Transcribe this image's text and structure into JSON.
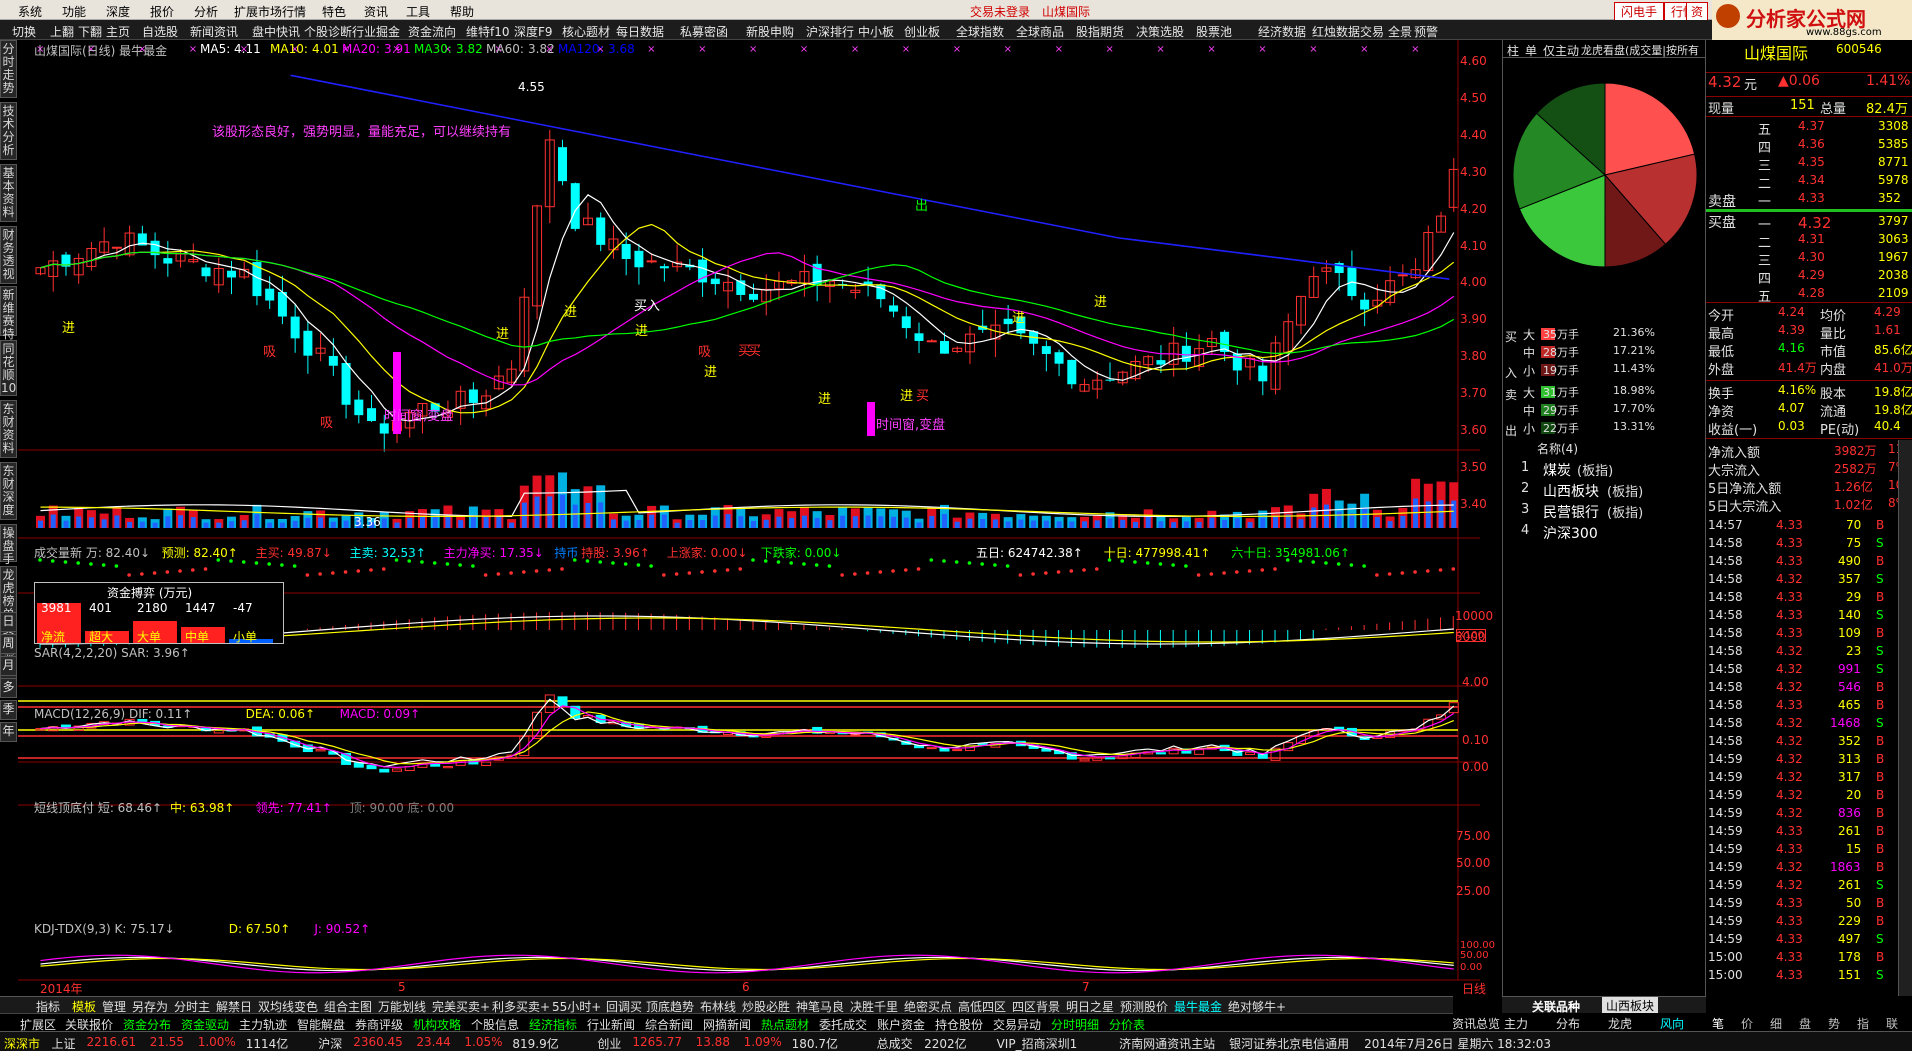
{
  "menu": {
    "items": [
      "系统",
      "功能",
      "深度",
      "报价",
      "分析",
      "扩展市场行情",
      "特色",
      "资讯",
      "工具",
      "帮助"
    ],
    "login_status": "交易未登录",
    "stock_name_top": "山煤国际",
    "right_buttons": [
      "闪电手",
      "行情",
      "资"
    ]
  },
  "toolbar": {
    "items": [
      "切换",
      "上翻",
      "下翻",
      "主页",
      "自选股",
      "新闻资讯",
      "盘中快讯",
      "个股诊断",
      "行业掘金",
      "资金流向",
      "维特f10",
      "深度F9",
      "核心题材",
      "每日数据",
      "私募密函",
      "新股申购",
      "沪深排行",
      "中小板",
      "创业板",
      "全球指数",
      "全球商品",
      "股指期货",
      "决策选股",
      "股票池",
      "经济数据",
      "红烛数据",
      "交易",
      "全景",
      "预警"
    ]
  },
  "logo": {
    "text": "分析家公式网",
    "url_text": "www.88gs.com"
  },
  "left_tabs": [
    "分时走势",
    "技术分析",
    "基本资料",
    "财务透视",
    "新维赛特",
    "同花顺10",
    "东财资料",
    "东财深度",
    "操盘手",
    "龙虎榜单",
    "资金流向"
  ],
  "period_tabs": [
    "日",
    "周",
    "月",
    "多",
    "季",
    "年"
  ],
  "main_chart": {
    "title": "山煤国际(日线) 最牛最金",
    "ma": [
      {
        "name": "MA5:",
        "value": "4.11",
        "color": "#ffffff"
      },
      {
        "name": "MA10:",
        "value": "4.01",
        "color": "#ffff00"
      },
      {
        "name": "MA20:",
        "value": "3.91",
        "color": "#ff00ff"
      },
      {
        "name": "MA30:",
        "value": "3.82",
        "color": "#00ff00"
      },
      {
        "name": "MA60:",
        "value": "3.82",
        "color": "#c0c0c0"
      },
      {
        "name": "MA120:",
        "value": "3.68",
        "color": "#0000ff"
      }
    ],
    "annotation": "该股形态良好，强势明显，量能充足，可以继续持有",
    "high_label": "4.55",
    "low_label": "3.36",
    "y_ticks": [
      "4.60",
      "4.50",
      "4.40",
      "4.30",
      "4.20",
      "4.10",
      "4.00",
      "3.90",
      "3.80",
      "3.70",
      "3.60",
      "3.50",
      "3.40"
    ],
    "signals": [
      "进",
      "进",
      "进",
      "进",
      "进",
      "进",
      "进",
      "进",
      "进",
      "出",
      "吸",
      "吸",
      "吸",
      "买",
      "买",
      "买",
      "时间窗,变盘",
      "时间窗,变盘",
      "买入"
    ]
  },
  "volume_panel": {
    "header": "成交量新 万: 82.40↓ 预测: 82.40↑ 主买: 49.87↓ 主卖: 32.53↑ 主力净买: 17.35↓ 持币 持股: 3.96↑ 上涨家: 0.00↓ 下跌家: 0.00↓",
    "header_parts": [
      {
        "t": "成交量新 万: 82.40↓",
        "c": "#c0c0c0"
      },
      {
        "t": "预测: 82.40↑",
        "c": "#ffff00"
      },
      {
        "t": "主买: 49.87↓",
        "c": "#ff3030"
      },
      {
        "t": "主卖: 32.53↑",
        "c": "#00ffff"
      },
      {
        "t": "主力净买: 17.35↓",
        "c": "#ff00ff"
      },
      {
        "t": "持币",
        "c": "#0080ff"
      },
      {
        "t": "持股: 3.96↑",
        "c": "#ff3030"
      },
      {
        "t": "上涨家: 0.00↓",
        "c": "#ff3030"
      },
      {
        "t": "下跌家: 0.00↓",
        "c": "#00ff00"
      }
    ],
    "right_header": [
      {
        "t": "五日: 624742.38↑",
        "c": "#ffffff"
      },
      {
        "t": "十日: 477998.41↑",
        "c": "#ffff00"
      },
      {
        "t": "六十日: 354981.06↑",
        "c": "#00ff00"
      }
    ],
    "y_ticks": [
      "10000",
      "5000",
      "X100"
    ],
    "fund_box": {
      "title": "资金搏弈 (万元)",
      "values": [
        "3981",
        "401",
        "2180",
        "1447",
        "-47"
      ],
      "labels": [
        "净流",
        "超大",
        "大单",
        "中单",
        "小单"
      ]
    }
  },
  "sar_panel": {
    "header": "SAR(4,2,2,20) SAR: 3.96↑",
    "y_ticks": [
      "4.00"
    ]
  },
  "macd_panel": {
    "header_parts": [
      {
        "t": "MACD(12,26,9) DIF: 0.11↑",
        "c": "#c0c0c0"
      },
      {
        "t": "DEA: 0.06↑",
        "c": "#ffff00"
      },
      {
        "t": "MACD: 0.09↑",
        "c": "#ff00ff"
      }
    ],
    "y_ticks": [
      "0.10",
      "0.00"
    ]
  },
  "short_panel": {
    "header_parts": [
      {
        "t": "短线顶底付 短: 68.46↑",
        "c": "#c0c0c0"
      },
      {
        "t": "中: 63.98↑",
        "c": "#ffff00"
      },
      {
        "t": "领先: 77.41↑",
        "c": "#ff00ff"
      },
      {
        "t": "顶: 90.00 底: 0.00",
        "c": "#808080"
      }
    ],
    "y_ticks": [
      "75.00",
      "50.00",
      "25.00"
    ]
  },
  "kdj_panel": {
    "header_parts": [
      {
        "t": "KDJ-TDX(9,3) K: 75.17↓",
        "c": "#c0c0c0"
      },
      {
        "t": "D: 67.50↑",
        "c": "#ffff00"
      },
      {
        "t": "J: 90.52↑",
        "c": "#ff00ff"
      }
    ],
    "y_ticks": [
      "100.00",
      "50.00",
      "0.00"
    ]
  },
  "x_axis": {
    "labels": [
      "2014年",
      "5",
      "6",
      "7"
    ],
    "right": "日线"
  },
  "mid_panel": {
    "tabs": [
      "柱",
      "单",
      "仅主动",
      "龙虎看盘(成交量|按所有"
    ],
    "flow": {
      "buy": [
        {
          "size": "大",
          "vol": "35万手",
          "pct": "21.36%",
          "color": "#ff4040"
        },
        {
          "size": "中",
          "vol": "28万手",
          "pct": "17.21%",
          "color": "#c02828"
        },
        {
          "size": "小",
          "vol": "19万手",
          "pct": "11.43%",
          "color": "#701818"
        }
      ],
      "sell": [
        {
          "size": "大",
          "vol": "31万手",
          "pct": "18.98%",
          "color": "#30c030"
        },
        {
          "size": "中",
          "vol": "29万手",
          "pct": "17.70%",
          "color": "#208020"
        },
        {
          "size": "小",
          "vol": "22万手",
          "pct": "13.31%",
          "color": "#104810"
        }
      ],
      "buy_label": [
        "买",
        "入"
      ],
      "sell_label": [
        "卖",
        "出"
      ]
    },
    "related_title": "名称(4)",
    "related": [
      {
        "n": "1",
        "name": "煤炭",
        "tag": "(板指)"
      },
      {
        "n": "2",
        "name": "山西板块",
        "tag": "(板指)"
      },
      {
        "n": "3",
        "name": "民营银行",
        "tag": "(板指)"
      },
      {
        "n": "4",
        "name": "沪深300",
        "tag": ""
      }
    ],
    "bottom_tabs": [
      "关联品种",
      "山西板块"
    ],
    "pie": {
      "values": [
        21.36,
        17.21,
        11.43,
        18.98,
        17.7,
        13.31
      ],
      "colors": [
        "#ff5050",
        "#b83030",
        "#701818",
        "#3cc83c",
        "#248824",
        "#145014"
      ]
    }
  },
  "quote": {
    "name": "山煤国际",
    "code": "600546",
    "price": "4.32",
    "price_unit": "元",
    "change": "▲0.06",
    "change_pct": "1.41%",
    "now_vol_label": "现量",
    "now_vol": "151",
    "total_label": "总量",
    "total": "82.4万",
    "sell": [
      {
        "l": "五",
        "p": "4.37",
        "v": "3308"
      },
      {
        "l": "四",
        "p": "4.36",
        "v": "5385"
      },
      {
        "l": "三",
        "p": "4.35",
        "v": "8771"
      },
      {
        "l": "二",
        "p": "4.34",
        "v": "5978"
      },
      {
        "l": "一",
        "p": "4.33",
        "v": "352"
      }
    ],
    "buy": [
      {
        "l": "一",
        "p": "4.32",
        "v": "3797"
      },
      {
        "l": "二",
        "p": "4.31",
        "v": "3063"
      },
      {
        "l": "三",
        "p": "4.30",
        "v": "1967"
      },
      {
        "l": "四",
        "p": "4.29",
        "v": "2038"
      },
      {
        "l": "五",
        "p": "4.28",
        "v": "2109"
      }
    ],
    "sell_label": "卖盘",
    "buy_label": "买盘",
    "stats": [
      [
        "今开",
        "4.24",
        "均价",
        "4.29"
      ],
      [
        "最高",
        "4.39",
        "量比",
        "1.61"
      ],
      [
        "最低",
        "4.16",
        "市值",
        "85.6亿"
      ],
      [
        "外盘",
        "41.4万",
        "内盘",
        "41.0万"
      ]
    ],
    "stats2": [
      [
        "换手",
        "4.16%",
        "股本",
        "19.8亿"
      ],
      [
        "净资",
        "4.07",
        "流通",
        "19.8亿"
      ],
      [
        "收益(一)",
        "0.03",
        "PE(动)",
        "40.4"
      ]
    ],
    "flows": [
      [
        "净流入额",
        "3982万",
        "11%"
      ],
      [
        "大宗流入",
        "2582万",
        "7%"
      ],
      [
        "5日净流入额",
        "1.26亿",
        "10%"
      ],
      [
        "5日大宗流入",
        "1.02亿",
        "8%"
      ]
    ]
  },
  "ticks": [
    [
      "14:57",
      "4.33",
      "70",
      "B"
    ],
    [
      "14:58",
      "4.33",
      "75",
      "S"
    ],
    [
      "14:58",
      "4.33",
      "490",
      "B"
    ],
    [
      "14:58",
      "4.32",
      "357",
      "S"
    ],
    [
      "14:58",
      "4.33",
      "29",
      "B"
    ],
    [
      "14:58",
      "4.33",
      "140",
      "S"
    ],
    [
      "14:58",
      "4.33",
      "109",
      "B"
    ],
    [
      "14:58",
      "4.32",
      "23",
      "S"
    ],
    [
      "14:58",
      "4.32",
      "991",
      "S"
    ],
    [
      "14:58",
      "4.32",
      "546",
      "B"
    ],
    [
      "14:58",
      "4.33",
      "465",
      "B"
    ],
    [
      "14:58",
      "4.32",
      "1468",
      "S"
    ],
    [
      "14:58",
      "4.32",
      "352",
      "B"
    ],
    [
      "14:59",
      "4.32",
      "313",
      "B"
    ],
    [
      "14:59",
      "4.32",
      "317",
      "B"
    ],
    [
      "14:59",
      "4.32",
      "20",
      "B"
    ],
    [
      "14:59",
      "4.32",
      "836",
      "B"
    ],
    [
      "14:59",
      "4.33",
      "261",
      "B"
    ],
    [
      "14:59",
      "4.33",
      "15",
      "B"
    ],
    [
      "14:59",
      "4.32",
      "1863",
      "B"
    ],
    [
      "14:59",
      "4.32",
      "261",
      "S"
    ],
    [
      "14:59",
      "4.33",
      "50",
      "B"
    ],
    [
      "14:59",
      "4.33",
      "229",
      "B"
    ],
    [
      "14:59",
      "4.33",
      "497",
      "S"
    ],
    [
      "15:00",
      "4.33",
      "178",
      "B"
    ],
    [
      "15:00",
      "4.33",
      "151",
      "S"
    ]
  ],
  "right_bottom_tabs": [
    "笔",
    "价",
    "细",
    "盘",
    "势",
    "指",
    "联"
  ],
  "mid_bottom_tabs": [
    "资讯总览",
    "主力",
    "分布",
    "龙虎",
    "风向"
  ],
  "bottom_tabs": [
    "指标",
    "模板",
    "管理",
    "另存为",
    "分时主",
    "解禁日",
    "双均线变色",
    "组合主图",
    "万能划线",
    "完美买卖+",
    "利多买卖+",
    "55小时+",
    "回调买",
    "顶底趋势",
    "布林线",
    "炒股必胜",
    "神笔马良",
    "决胜千里",
    "绝密买点",
    "高低四区",
    "四区背景",
    "明日之星",
    "预测股价",
    "最牛最金",
    "绝对够牛+"
  ],
  "func_tabs": [
    "扩展区",
    "关联报价",
    "资金分布",
    "资金驱动",
    "主力轨迹",
    "智能解盘",
    "券商评级",
    "机构攻略",
    "个股信息",
    "经济指标",
    "行业新闻",
    "综合新闻",
    "网摘新闻",
    "热点题材",
    "委托成交",
    "账户资金",
    "持仓股份",
    "交易异动",
    "分时明细",
    "分价表"
  ],
  "status": [
    {
      "t": "深深市",
      "c": "#ffff00"
    },
    {
      "t": "上证",
      "c": "#e0e0e0"
    },
    {
      "t": "2216.61",
      "c": "#ff3030"
    },
    {
      "t": "21.55",
      "c": "#ff3030"
    },
    {
      "t": "1.00%",
      "c": "#ff3030"
    },
    {
      "t": "1114亿",
      "c": "#e0e0e0"
    },
    {
      "t": "沪深",
      "c": "#e0e0e0"
    },
    {
      "t": "2360.45",
      "c": "#ff3030"
    },
    {
      "t": "23.44",
      "c": "#ff3030"
    },
    {
      "t": "1.05%",
      "c": "#ff3030"
    },
    {
      "t": "819.9亿",
      "c": "#e0e0e0"
    },
    {
      "t": "创业",
      "c": "#e0e0e0"
    },
    {
      "t": "1265.77",
      "c": "#ff3030"
    },
    {
      "t": "13.88",
      "c": "#ff3030"
    },
    {
      "t": "1.09%",
      "c": "#ff3030"
    },
    {
      "t": "180.7亿",
      "c": "#e0e0e0"
    },
    {
      "t": "总成交",
      "c": "#e0e0e0"
    },
    {
      "t": "2202亿",
      "c": "#e0e0e0"
    },
    {
      "t": "VIP_招商深圳1",
      "c": "#e0e0e0"
    },
    {
      "t": "济南网通资讯主站",
      "c": "#e0e0e0"
    },
    {
      "t": "银河证券北京电信通用",
      "c": "#e0e0e0"
    },
    {
      "t": "2014年7月26日  星期六  18:32:03",
      "c": "#e0e0e0"
    }
  ],
  "colors": {
    "up": "#ff3030",
    "down": "#00ffff",
    "bg": "#000000",
    "grid": "#8b0000"
  }
}
